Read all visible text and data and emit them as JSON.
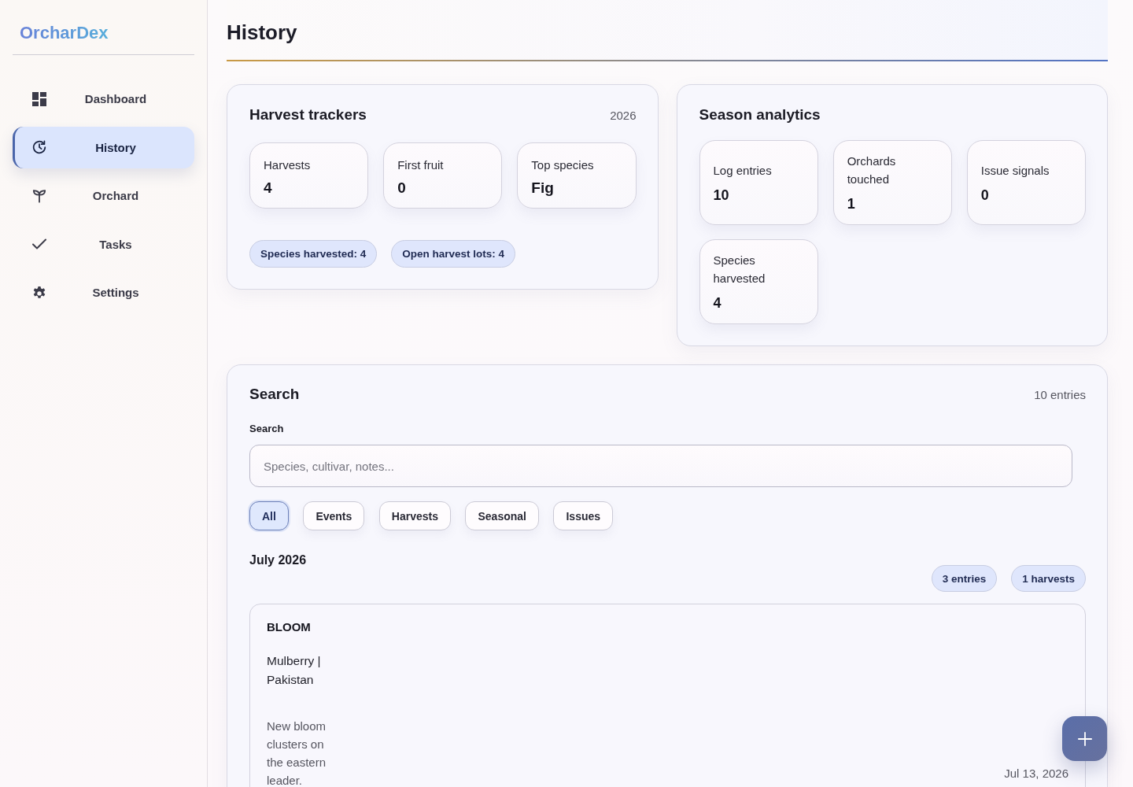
{
  "sidebar": {
    "logo": "OrcharDex",
    "items": [
      {
        "label": "Dashboard",
        "selected": false
      },
      {
        "label": "History",
        "selected": true
      },
      {
        "label": "Orchard",
        "selected": false
      },
      {
        "label": "Tasks",
        "selected": false
      },
      {
        "label": "Settings",
        "selected": false
      }
    ]
  },
  "page": {
    "title": "History"
  },
  "harvest_trackers": {
    "title": "Harvest trackers",
    "year": "2026",
    "stats": [
      {
        "label": "Harvests",
        "value": "4"
      },
      {
        "label": "First fruit",
        "value": "0"
      },
      {
        "label": "Top species",
        "value": "Fig"
      }
    ],
    "chips": [
      "Species harvested: 4",
      "Open harvest lots: 4"
    ]
  },
  "season_analytics": {
    "title": "Season analytics",
    "stats": [
      {
        "label": "Log entries",
        "value": "10"
      },
      {
        "label": "Orchards touched",
        "value": "1"
      },
      {
        "label": "Issue signals",
        "value": "0"
      },
      {
        "label": "Species harvested",
        "value": "4"
      }
    ]
  },
  "search": {
    "title": "Search",
    "count": "10 entries",
    "field_label": "Search",
    "placeholder": "Species, cultivar, notes...",
    "filters": [
      {
        "label": "All",
        "selected": true
      },
      {
        "label": "Events",
        "selected": false
      },
      {
        "label": "Harvests",
        "selected": false
      },
      {
        "label": "Seasonal",
        "selected": false
      },
      {
        "label": "Issues",
        "selected": false
      }
    ],
    "groups": [
      {
        "month": "July 2026",
        "chips": [
          "3 entries",
          "1 harvests"
        ],
        "entries": [
          {
            "type": "BLOOM",
            "subject": "Mulberry | Pakistan",
            "notes": "New bloom clusters on the eastern leader.",
            "date": "Jul 13, 2026"
          }
        ]
      }
    ]
  }
}
